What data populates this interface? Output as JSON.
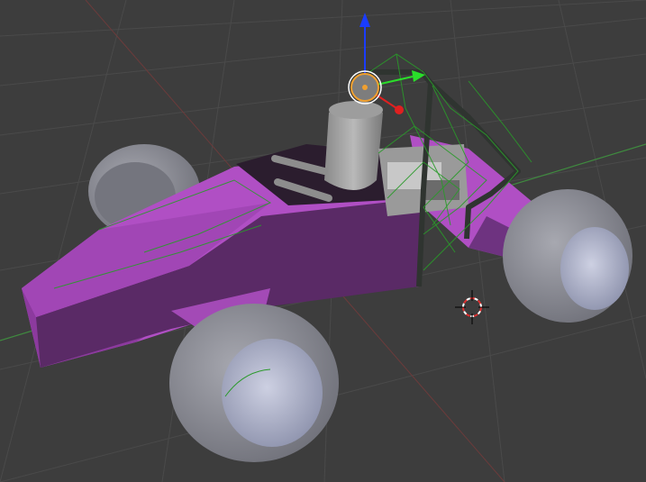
{
  "viewport": {
    "background": "#3d3d3d",
    "grid_color": "#4a4a4a",
    "x_axis_color": "#8a3535",
    "y_axis_color": "#3f8a3f"
  },
  "model": {
    "body_color": "#b04fc4",
    "body_shadow_color": "#5a2a66",
    "wireframe_color": "#2a9a2a",
    "tire_color": "#8d8d96",
    "rim_color": "#b8bcd0"
  },
  "gizmo": {
    "z_axis_color": "#1a3cff",
    "y_axis_color": "#2adf2a",
    "x_axis_color": "#e02020",
    "origin_color": "#f0a030"
  }
}
